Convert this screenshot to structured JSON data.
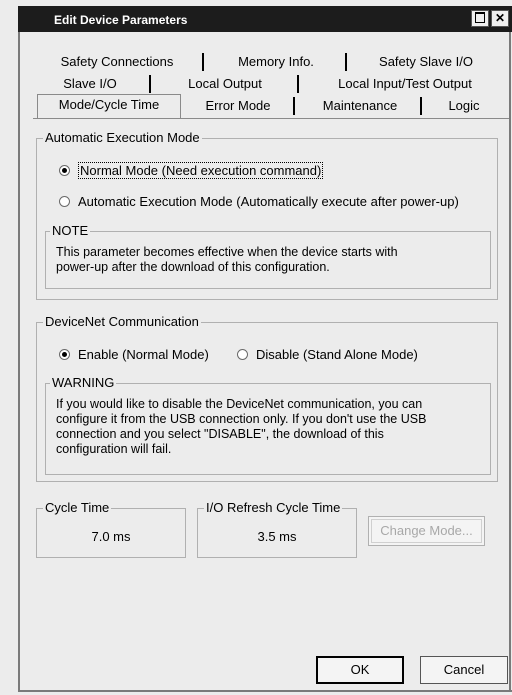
{
  "window": {
    "title": "Edit Device Parameters"
  },
  "tabs": {
    "row1": [
      "Safety Connections",
      "Memory Info.",
      "Safety Slave I/O"
    ],
    "row2": [
      "Slave I/O",
      "Local Output",
      "Local Input/Test Output"
    ],
    "row3": [
      "Mode/Cycle Time",
      "Error Mode",
      "Maintenance",
      "Logic"
    ],
    "active": "Mode/Cycle Time"
  },
  "execution": {
    "label": "Automatic Execution Mode",
    "options": [
      {
        "label": "Normal Mode (Need execution command)",
        "selected": true
      },
      {
        "label": "Automatic Execution Mode (Automatically execute after power-up)",
        "selected": false
      }
    ],
    "note_title": "NOTE",
    "note_line1": "This parameter becomes effective when the device starts with",
    "note_line2": "power-up after the download of this configuration."
  },
  "devicenet": {
    "label": "DeviceNet Communication",
    "options": [
      {
        "label": "Enable (Normal Mode)",
        "selected": true
      },
      {
        "label": "Disable (Stand Alone Mode)",
        "selected": false
      }
    ],
    "warning_title": "WARNING",
    "warning_line1": "If you would like to disable the DeviceNet communication, you can",
    "warning_line2": "configure it from the USB connection only. If you don't use the USB",
    "warning_line3": "connection and you select \"DISABLE\", the download of this",
    "warning_line4": "configuration will fail."
  },
  "cycle": {
    "cycle_label": "Cycle Time",
    "cycle_value": "7.0 ms",
    "refresh_label": "I/O Refresh Cycle Time",
    "refresh_value": "3.5 ms",
    "change_mode_label": "Change Mode..."
  },
  "footer": {
    "ok_label": "OK",
    "cancel_label": "Cancel"
  },
  "colors": {
    "titlebar": "#1c1c1c",
    "background": "#ececec"
  }
}
